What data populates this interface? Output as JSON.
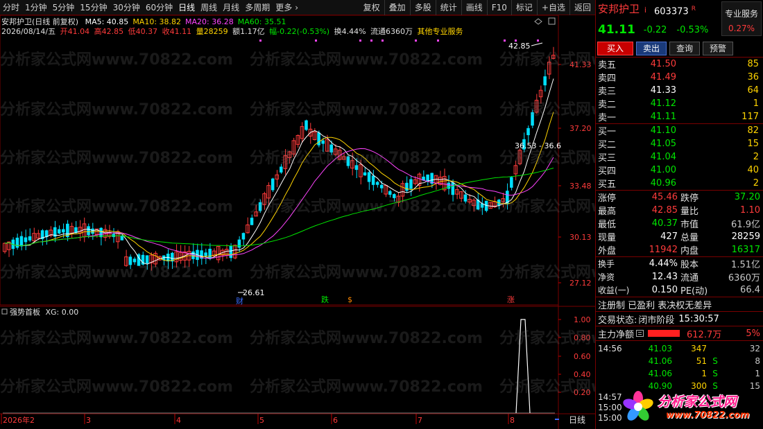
{
  "toolbar": {
    "periods": [
      "分时",
      "1分钟",
      "5分钟",
      "15分钟",
      "30分钟",
      "60分钟",
      "日线",
      "周线",
      "月线",
      "多周期",
      "更多"
    ],
    "active_index": 6,
    "more_arrow": "›",
    "actions": [
      "复权",
      "叠加",
      "多股",
      "统计",
      "画线",
      "F10",
      "标记",
      "+自选",
      "返回"
    ]
  },
  "chart": {
    "title_line": "安邦护卫(日线 前复权)",
    "ma_legend": [
      {
        "label": "MA5: 40.85",
        "color": "#ffffff"
      },
      {
        "label": "MA10: 38.82",
        "color": "#ffd400"
      },
      {
        "label": "MA20: 36.28",
        "color": "#ff44ff"
      },
      {
        "label": "MA60: 35.51",
        "color": "#00e600"
      }
    ],
    "bar_info": {
      "date": "2026/08/14/五",
      "open": "开41.04",
      "high": "高42.85",
      "low": "低40.37",
      "close": "收41.11",
      "vol": "量28259",
      "amount": "额1.17亿",
      "change": "幅-0.22(-0.53%)",
      "turnover": "换4.44%",
      "float": "流通6360万",
      "service": "其他专业服务"
    },
    "price_axis": [
      "41.33",
      "37.20",
      "33.48",
      "30.13",
      "27.12"
    ],
    "annotations": {
      "high_label": "42.85",
      "low_label": "26.61",
      "range_label": "36.53 - 36.6",
      "marker_cai": "财",
      "marker_die": "跌",
      "marker_s": "$",
      "marker_zhang": "涨"
    },
    "indicator_title": "强势首板",
    "indicator_value": "XG: 0.00",
    "indicator_axis": [
      "1.00",
      "0.80",
      "0.60",
      "0.40",
      "0.20"
    ],
    "time_axis": [
      "2026年2",
      "3",
      "4",
      "5",
      "6",
      "7",
      "8"
    ],
    "period_label": "日线",
    "watermark": "分析家公式网www.70822.com"
  },
  "panel": {
    "name": "安邦护卫",
    "name_flag": "i",
    "code": "603373",
    "code_flag": "R",
    "pro_service": "专业服务",
    "pro_pct": "0.27%",
    "price": "41.11",
    "change": "-0.22",
    "change_pct": "-0.53%",
    "buttons": {
      "buy": "买入",
      "sell": "卖出",
      "query": "查询",
      "alert": "预警"
    },
    "asks": [
      {
        "label": "卖五",
        "price": "41.50",
        "vol": "85",
        "color": "red"
      },
      {
        "label": "卖四",
        "price": "41.49",
        "vol": "36",
        "color": "red"
      },
      {
        "label": "卖三",
        "price": "41.33",
        "vol": "64",
        "color": "white"
      },
      {
        "label": "卖二",
        "price": "41.12",
        "vol": "1",
        "color": "green"
      },
      {
        "label": "卖一",
        "price": "41.11",
        "vol": "117",
        "color": "green"
      }
    ],
    "bids": [
      {
        "label": "买一",
        "price": "41.10",
        "vol": "82",
        "color": "green"
      },
      {
        "label": "买二",
        "price": "41.05",
        "vol": "15",
        "color": "green"
      },
      {
        "label": "买三",
        "price": "41.04",
        "vol": "2",
        "color": "green"
      },
      {
        "label": "买四",
        "price": "41.00",
        "vol": "40",
        "color": "green"
      },
      {
        "label": "买五",
        "price": "40.96",
        "vol": "2",
        "color": "green"
      }
    ],
    "stats1": [
      {
        "k": "涨停",
        "v": "45.46",
        "vc": "red",
        "k2": "跌停",
        "v2": "37.20",
        "v2c": "green"
      },
      {
        "k": "最高",
        "v": "42.85",
        "vc": "red",
        "k2": "量比",
        "v2": "1.10",
        "v2c": "red"
      },
      {
        "k": "最低",
        "v": "40.37",
        "vc": "green",
        "k2": "市值",
        "v2": "61.9亿",
        "v2c": "gray"
      },
      {
        "k": "现量",
        "v": "427",
        "vc": "white",
        "k2": "总量",
        "v2": "28259",
        "v2c": "white"
      },
      {
        "k": "外盘",
        "v": "11942",
        "vc": "red",
        "k2": "内盘",
        "v2": "16317",
        "v2c": "green"
      }
    ],
    "stats2": [
      {
        "k": "换手",
        "v": "4.44%",
        "vc": "white",
        "k2": "股本",
        "v2": "1.51亿",
        "v2c": "gray"
      },
      {
        "k": "净资",
        "v": "12.43",
        "vc": "white",
        "k2": "流通",
        "v2": "6360万",
        "v2c": "gray"
      },
      {
        "k": "收益(一)",
        "v": "0.150",
        "vc": "white",
        "k2": "PE(动)",
        "v2": "66.4",
        "v2c": "gray"
      }
    ],
    "reg_info": "注册制 已盈利 表决权无差异",
    "trade_state_label": "交易状态:",
    "trade_state": "闭市阶段",
    "trade_time": "15:30:57",
    "main_net_label": "主力净额",
    "main_net_value": "612.7万",
    "main_net_pct": "5%",
    "ticks": [
      {
        "t": "14:56",
        "p": "41.03",
        "q": "347",
        "s": "",
        "n": "32"
      },
      {
        "t": "",
        "p": "41.06",
        "q": "51",
        "s": "S",
        "n": "8"
      },
      {
        "t": "",
        "p": "41.06",
        "q": "1",
        "s": "S",
        "n": "1"
      },
      {
        "t": "",
        "p": "40.90",
        "q": "300",
        "s": "S",
        "n": "15"
      }
    ],
    "tick_times_bottom": [
      "14:57",
      "15:00",
      "15:00"
    ]
  },
  "logo": {
    "text": "分析家公式网",
    "url": "www.70822.com"
  }
}
